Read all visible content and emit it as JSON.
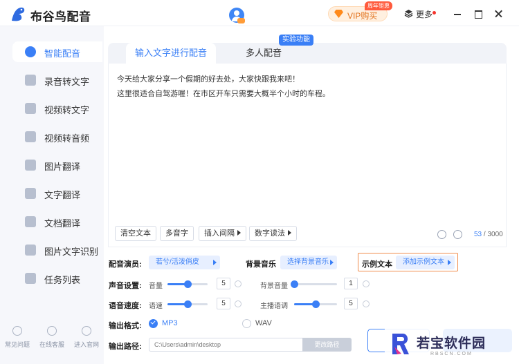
{
  "app": {
    "name": "布谷鸟配音"
  },
  "header": {
    "vip_label": "VIP购买",
    "vip_tag": "周年钜惠",
    "more_label": "更多"
  },
  "sidebar": {
    "items": [
      {
        "label": "智能配音",
        "icon": "microphone-icon",
        "active": true
      },
      {
        "label": "录音转文字",
        "icon": "record-to-text-icon"
      },
      {
        "label": "视频转文字",
        "icon": "video-to-text-icon"
      },
      {
        "label": "视频转音频",
        "icon": "video-to-audio-icon"
      },
      {
        "label": "图片翻译",
        "icon": "image-translate-icon"
      },
      {
        "label": "文字翻译",
        "icon": "text-translate-icon"
      },
      {
        "label": "文档翻译",
        "icon": "document-translate-icon"
      },
      {
        "label": "图片文字识别",
        "icon": "ocr-icon"
      },
      {
        "label": "任务列表",
        "icon": "task-list-icon"
      }
    ],
    "bottom": [
      {
        "label": "常见问题",
        "icon": "help-icon"
      },
      {
        "label": "在线客服",
        "icon": "chat-icon"
      },
      {
        "label": "进入官网",
        "icon": "website-icon"
      }
    ]
  },
  "tabs": [
    {
      "label": "输入文字进行配音",
      "active": true
    },
    {
      "label": "多人配音"
    }
  ],
  "experiment_badge": "实验功能",
  "editor": {
    "lines": [
      "今天给大家分享一个假期的好去处，大家快跟我来吧！",
      "这里很适合自驾游喔！在市区开车只需要大概半个小时的车程。"
    ],
    "toolbar": {
      "clear": "清空文本",
      "polyphone": "多音字",
      "insert_pause": "插入间隔",
      "number_reading": "数字读法"
    },
    "counter_current": "53",
    "counter_max": "/ 3000"
  },
  "settings": {
    "voice_label": "配音演员:",
    "voice_value": "若兮/活泼俏皮",
    "bgm_label": "背景音乐",
    "bgm_value": "选择背景音乐",
    "example_label": "示例文本",
    "example_value": "添加示例文本",
    "sound_label": "声音设置:",
    "speed_label": "语音速度:",
    "volume_label": "音量",
    "volume_value": "5",
    "volume_level": 0.5,
    "bg_volume_label": "背景音量",
    "bg_volume_value": "1",
    "bg_volume_level": 0.0,
    "rate_label": "语速",
    "rate_value": "5",
    "rate_level": 0.5,
    "pitch_label": "主播语调",
    "pitch_value": "5",
    "pitch_level": 0.5,
    "format_label": "输出格式:",
    "format_mp3": "MP3",
    "format_wav": "WAV",
    "path_label": "输出路径:",
    "path_value": "C:\\Users\\admin\\desktop",
    "change_path": "更改路径"
  },
  "watermark": {
    "text": "若宝软件园",
    "sub": "RBSCN.COM"
  },
  "colors": {
    "accent": "#3a7ff6",
    "highlight_border": "#f08b4a",
    "vip": "#e2711b"
  }
}
